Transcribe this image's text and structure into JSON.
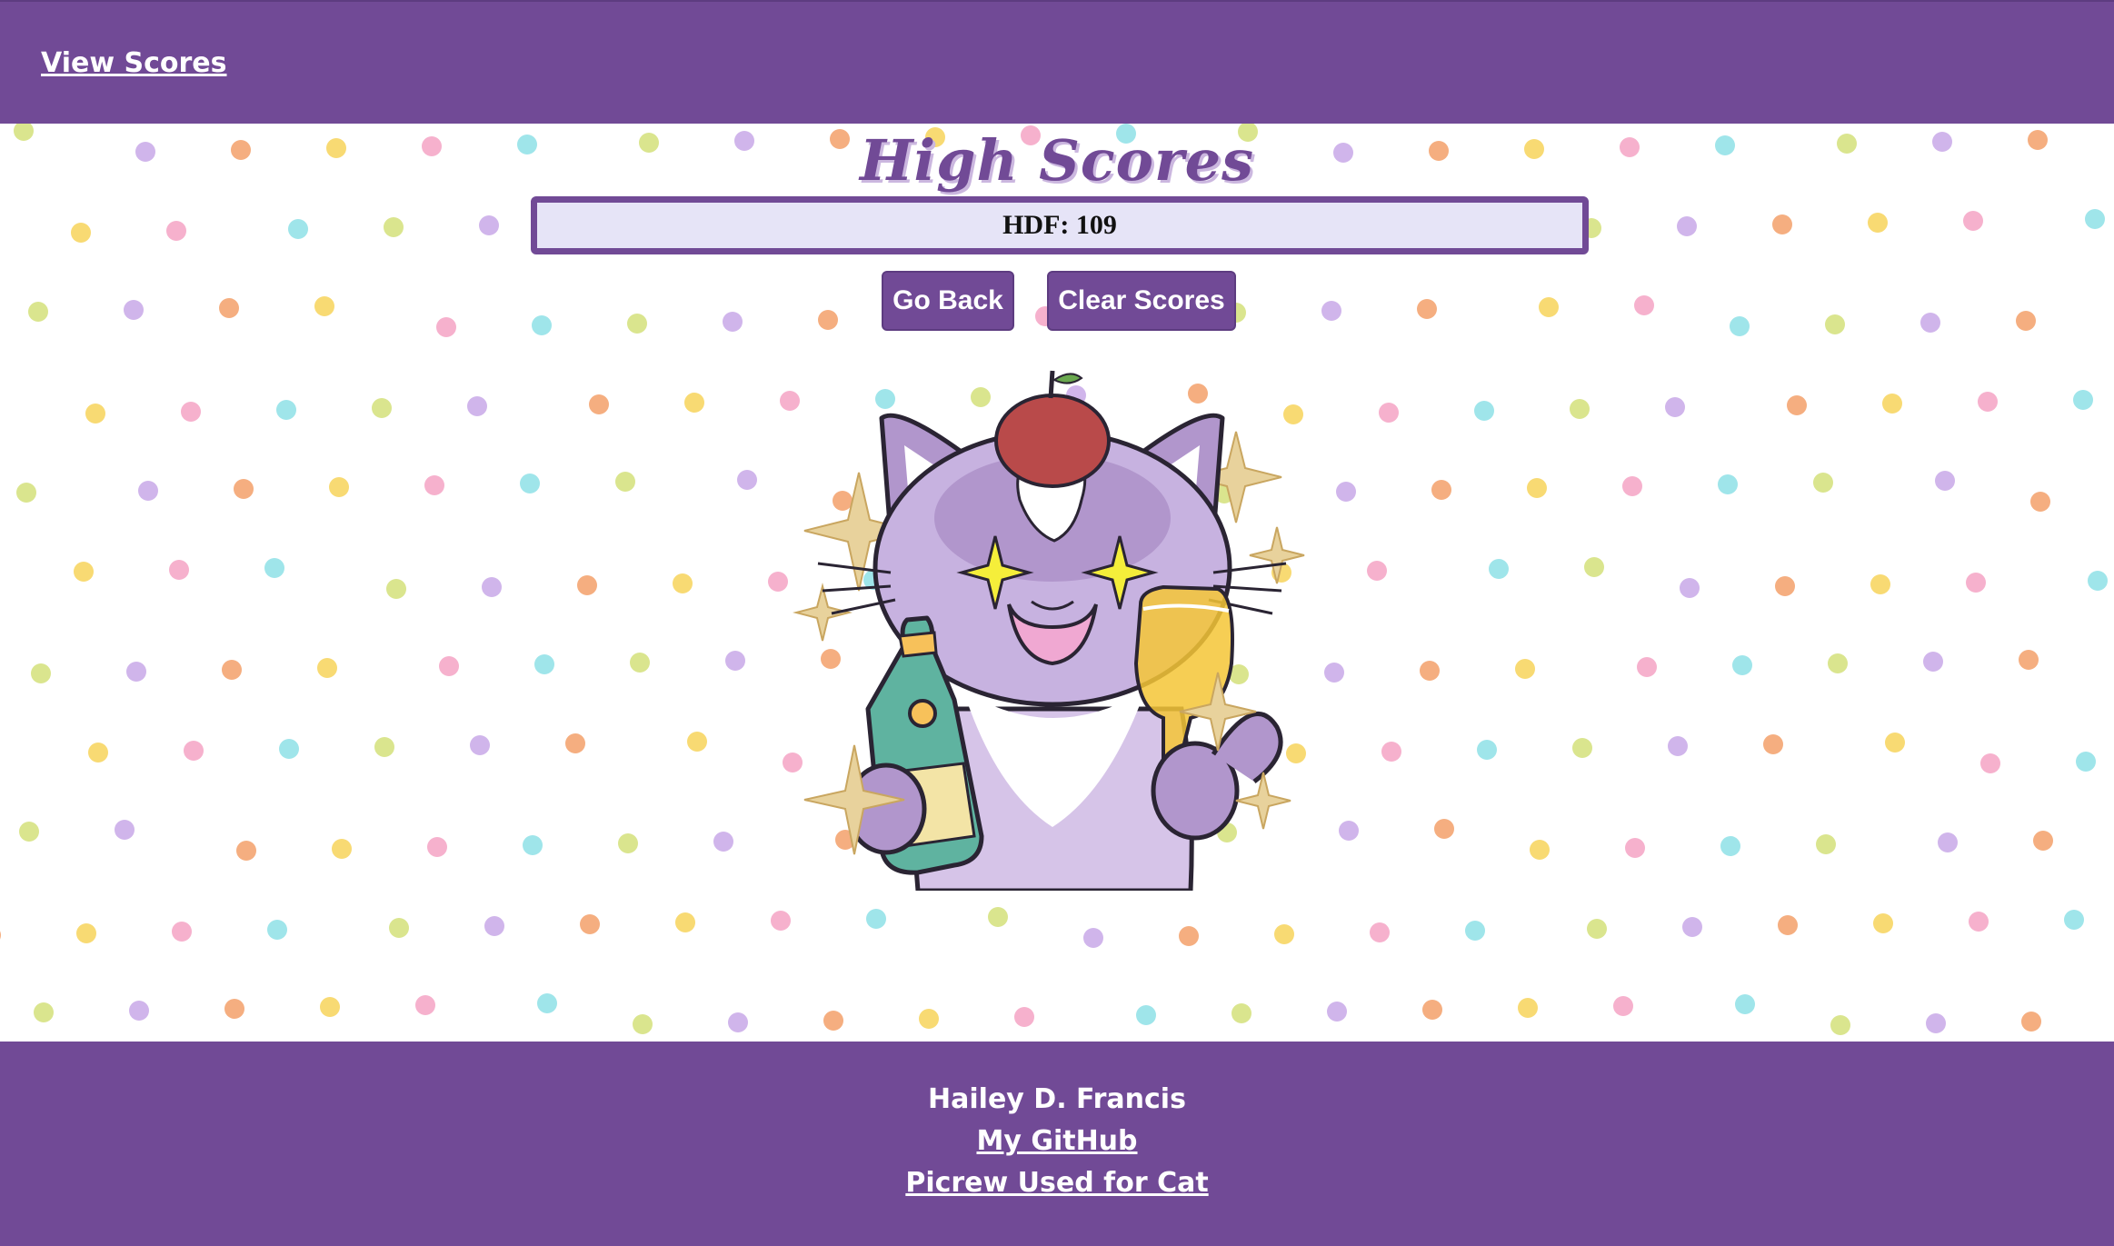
{
  "header": {
    "view_scores_label": "View Scores"
  },
  "main": {
    "title": "High Scores",
    "scores": [
      "HDF: 109"
    ],
    "go_back_label": "Go Back",
    "clear_scores_label": "Clear Scores",
    "image": {
      "icon": "celebrating-purple-cat-illustration"
    }
  },
  "footer": {
    "author": "Hailey D. Francis",
    "github_label": "My GitHub",
    "picrew_label": "Picrew Used for Cat"
  },
  "colors": {
    "brand_purple": "#714a96",
    "score_bg": "#e6e4f7",
    "dot_palette": [
      "#d4e07a",
      "#8ee0e6",
      "#f4a3c4",
      "#f7d35a",
      "#f3a06a",
      "#c8a8e8"
    ]
  }
}
